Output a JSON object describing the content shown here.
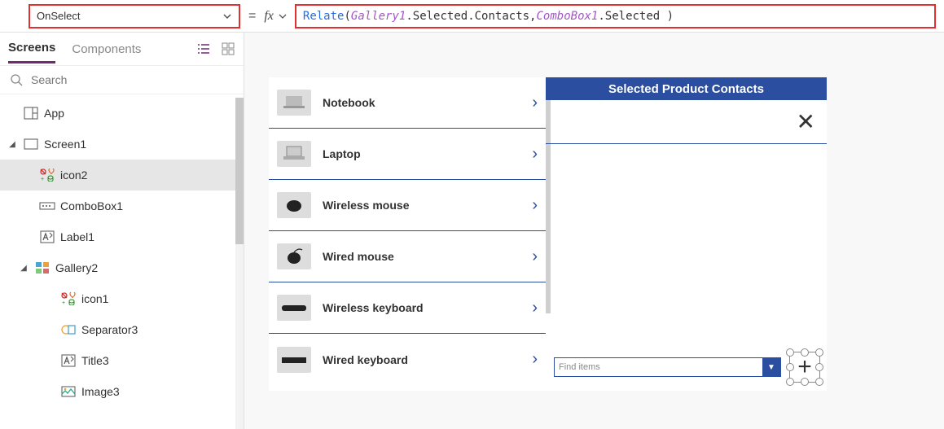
{
  "property_selector": {
    "value": "OnSelect"
  },
  "formula": {
    "fn": "Relate",
    "open": "( ",
    "arg1": "Gallery1",
    "arg1_tail": ".Selected.Contacts, ",
    "arg2": "ComboBox1",
    "arg2_tail": ".Selected )"
  },
  "left_panel": {
    "tabs": {
      "screens": "Screens",
      "components": "Components"
    },
    "search_placeholder": "Search",
    "tree": [
      {
        "id": "app",
        "label": "App",
        "icon": "app",
        "indent": 0
      },
      {
        "id": "screen1",
        "label": "Screen1",
        "icon": "screen",
        "indent": 0,
        "expanded": true
      },
      {
        "id": "icon2",
        "label": "icon2",
        "icon": "iconset",
        "indent": 2,
        "selected": true
      },
      {
        "id": "combobox1",
        "label": "ComboBox1",
        "icon": "combobox",
        "indent": 2
      },
      {
        "id": "label1",
        "label": "Label1",
        "icon": "label",
        "indent": 2
      },
      {
        "id": "gallery2",
        "label": "Gallery2",
        "icon": "gallery",
        "indent": 1,
        "expanded": true
      },
      {
        "id": "icon1",
        "label": "icon1",
        "icon": "iconset",
        "indent": 3
      },
      {
        "id": "separator3",
        "label": "Separator3",
        "icon": "separator",
        "indent": 3
      },
      {
        "id": "title3",
        "label": "Title3",
        "icon": "label",
        "indent": 3
      },
      {
        "id": "image3",
        "label": "Image3",
        "icon": "image",
        "indent": 3
      }
    ]
  },
  "canvas": {
    "gallery_items": [
      {
        "label": "Notebook"
      },
      {
        "label": "Laptop"
      },
      {
        "label": "Wireless mouse"
      },
      {
        "label": "Wired mouse"
      },
      {
        "label": "Wireless keyboard"
      },
      {
        "label": "Wired keyboard"
      }
    ],
    "header": "Selected Product Contacts",
    "combo_placeholder": "Find items"
  }
}
